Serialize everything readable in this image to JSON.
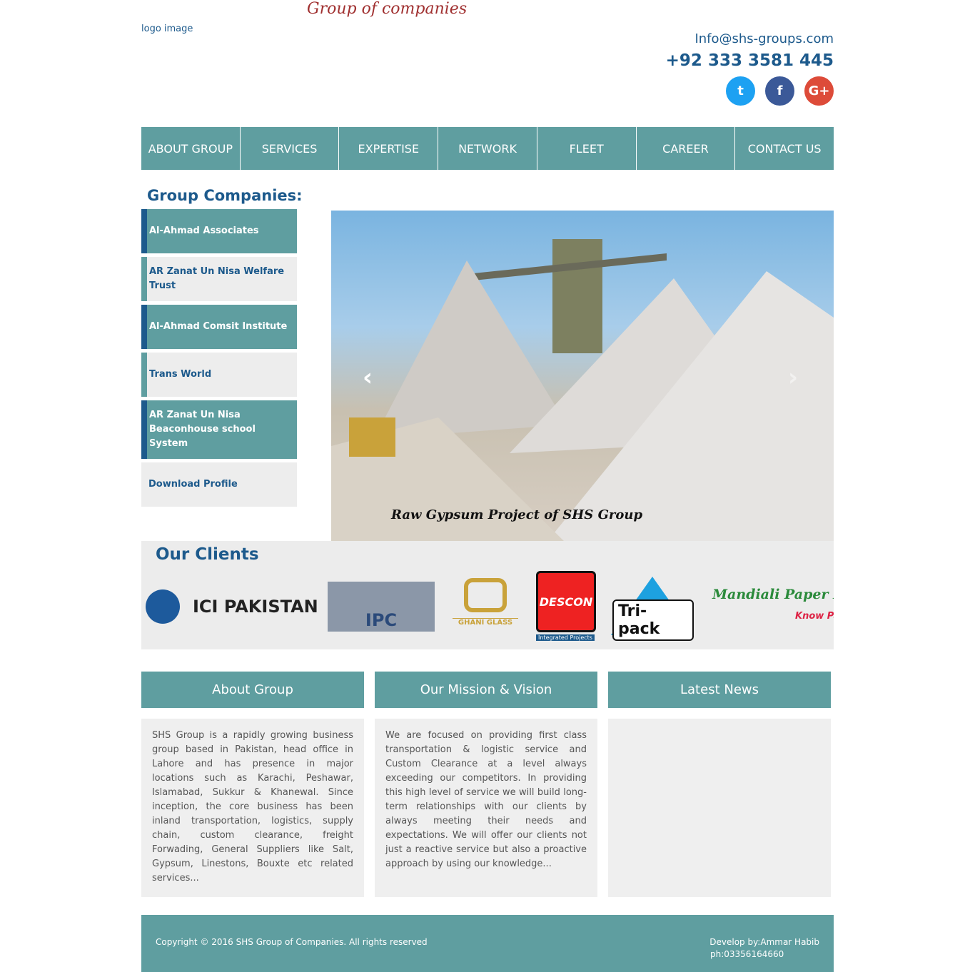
{
  "header": {
    "tagline": "Group of companies",
    "logo_alt": "logo image",
    "email": "Info@shs-groups.com",
    "phone": "+92 333 3581 445",
    "social": {
      "twitter_icon": "twitter-icon",
      "facebook_icon": "facebook-icon",
      "google_icon": "google-plus-icon",
      "twitter_glyph": "t",
      "facebook_glyph": "f",
      "google_glyph": "G+"
    }
  },
  "nav": [
    "ABOUT GROUP",
    "SERVICES",
    "EXPERTISE",
    "NETWORK",
    "FLEET",
    "CAREER",
    "CONTACT US"
  ],
  "sidebar": {
    "title": "Group Companies:",
    "items": [
      "Al-Ahmad Associates",
      "AR Zanat Un Nisa Welfare Trust",
      "Al-Ahmad Comsit Institute",
      "Trans World",
      "AR Zanat Un Nisa Beaconhouse school System",
      "Download Profile"
    ]
  },
  "slider": {
    "caption": "Raw Gypsum Project of SHS Group",
    "prev": "‹",
    "next": "›"
  },
  "clients": {
    "title": "Our Clients",
    "logos": [
      "ICI PAKISTAN",
      "IPC",
      "GHANI GLASS",
      "DESCON",
      "Integrated Projects",
      "Tri-pack",
      "Mandiali Paper Mil",
      "Know Pape"
    ]
  },
  "about": {
    "title": "About Group",
    "text": "SHS Group is a rapidly growing business group based in Pakistan, head office in Lahore and has presence in major locations such as Karachi, Peshawar, Islamabad, Sukkur & Khanewal. Since inception, the core business has been inland transportation, logistics, supply chain, custom clearance, freight Forwading, General Suppliers like Salt, Gypsum, Linestons, Bouxte etc related services..."
  },
  "mission": {
    "title": "Our Mission & Vision",
    "text": "We are focused on providing first class transportation & logistic service and Custom Clearance at a level always exceeding our competitors. In providing this high level of service we will build long-term relationships with our clients by always meeting their needs and expectations. We will offer our clients not just a reactive service but also a proactive approach by using our knowledge..."
  },
  "news": {
    "title": "Latest News"
  },
  "footer": {
    "copyright": "Copyright © 2016 SHS Group of Companies. All rights reserved",
    "developer": "Develop by:Ammar Habib",
    "developer_phone": "ph:03356164660"
  }
}
